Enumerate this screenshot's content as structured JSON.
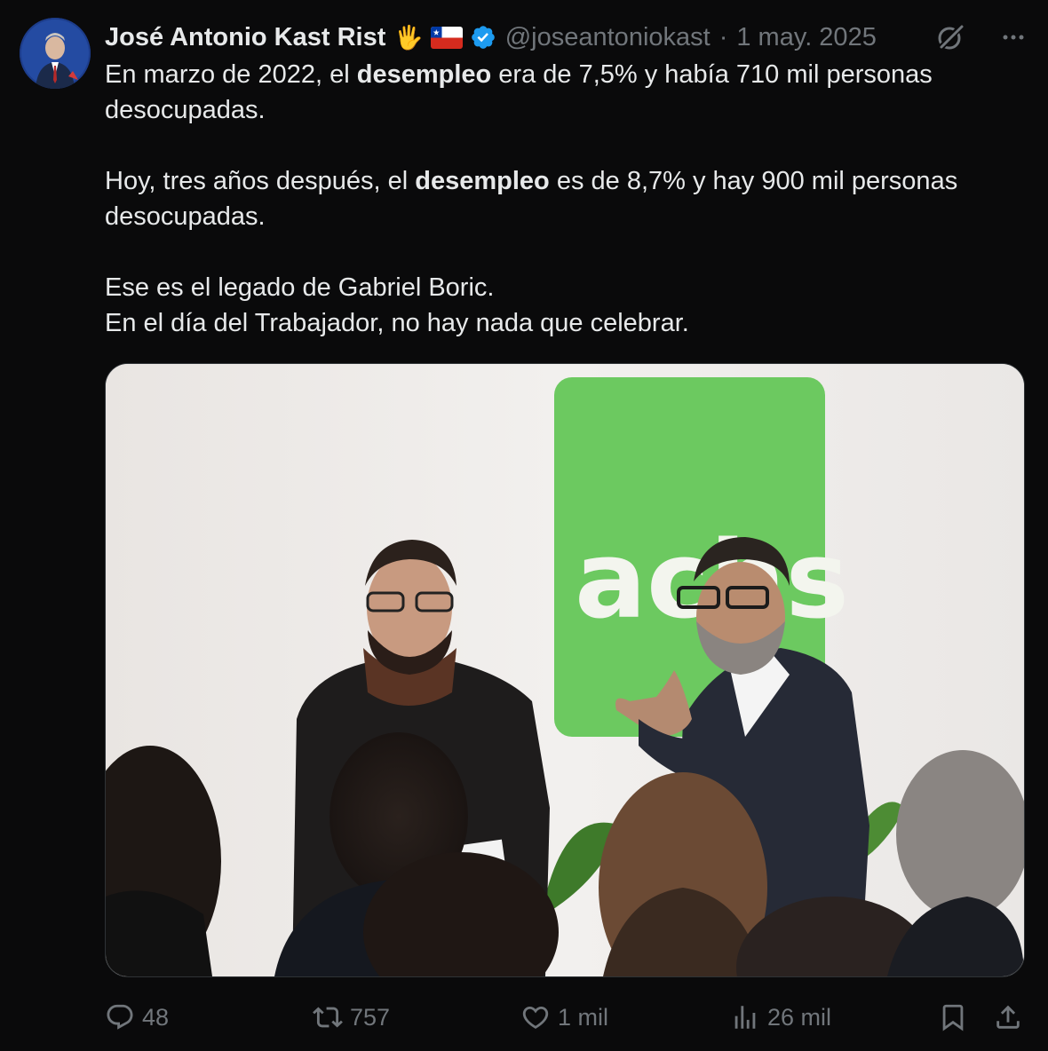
{
  "author": {
    "name": "José Antonio Kast Rist",
    "emoji": "🖐",
    "handle": "@joseantoniokast",
    "separator": "·",
    "date": "1 may. 2025"
  },
  "tweet": {
    "p1_a": "En marzo de 2022, el ",
    "p1_b": "desempleo",
    "p1_c": " era de 7,5% y había 710 mil personas desocupadas.",
    "p2_a": "Hoy, tres años después, el ",
    "p2_b": "desempleo",
    "p2_c": " es de 8,7% y hay 900 mil personas desocupadas.",
    "p3": "Ese es el legado de Gabriel Boric.",
    "p4": "En el día del Trabajador, no hay nada que celebrar."
  },
  "media": {
    "sign_text": "achs",
    "sign_color": "#6cc960"
  },
  "actions": {
    "replies": "48",
    "reposts": "757",
    "likes": "1 mil",
    "views": "26 mil"
  },
  "colors": {
    "background": "#0a0a0b",
    "text": "#e7e9ea",
    "muted": "#71767b",
    "verified": "#1d9bf0"
  },
  "icons": [
    "grok-icon",
    "more-icon",
    "reply-icon",
    "repost-icon",
    "like-icon",
    "views-icon",
    "bookmark-icon",
    "share-icon",
    "verified-icon",
    "chile-flag-icon"
  ]
}
